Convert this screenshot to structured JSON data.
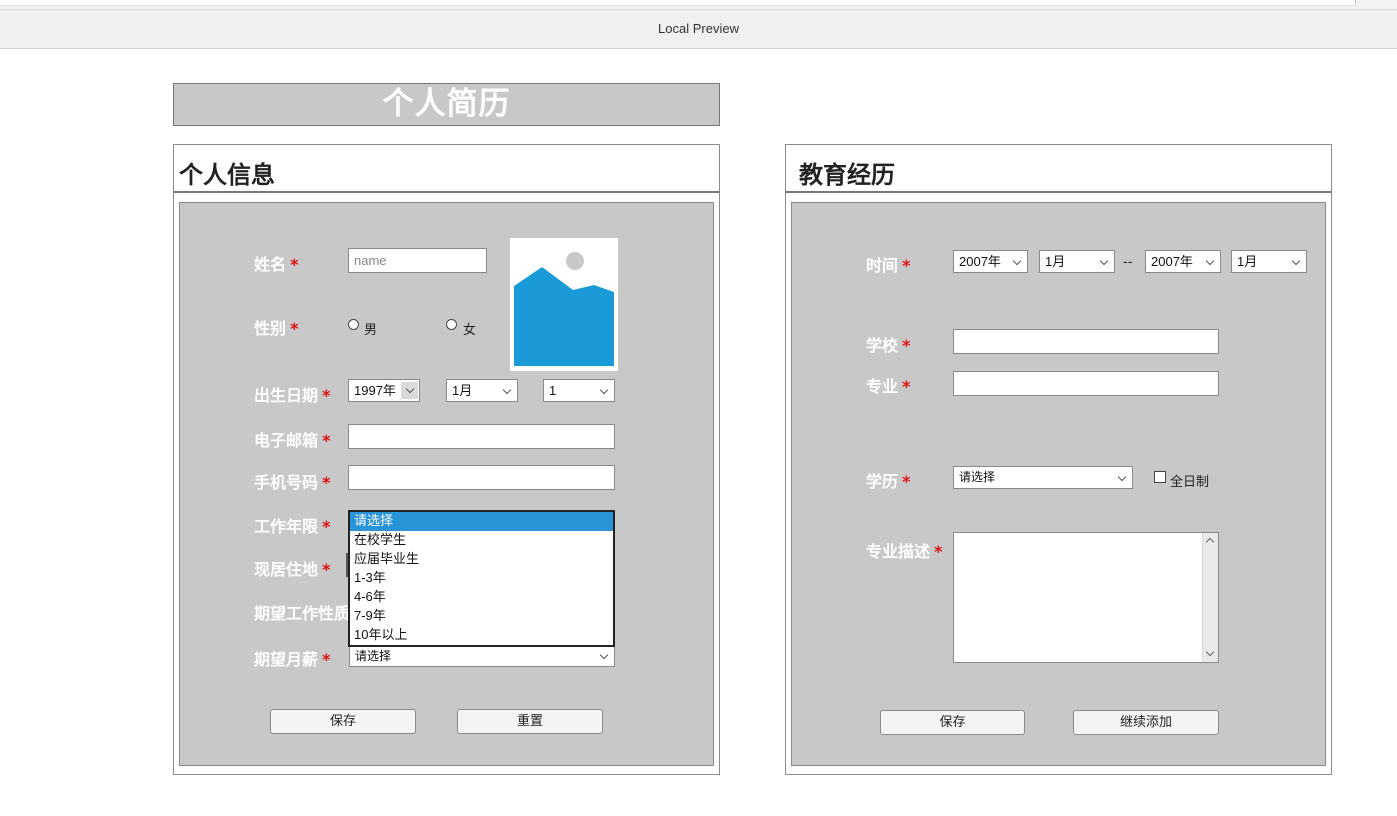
{
  "window": {
    "title": "Local Preview"
  },
  "resume": {
    "title": "个人简历"
  },
  "personal": {
    "heading": "个人信息",
    "name_label": "姓名",
    "name_placeholder": "name",
    "gender_label": "性别",
    "gender_male": "男",
    "gender_female": "女",
    "birth_label": "出生日期",
    "birth_year": "1997年",
    "birth_month": "1月",
    "birth_day": "1",
    "email_label": "电子邮箱",
    "phone_label": "手机号码",
    "work_years_label": "工作年限",
    "work_years_options": [
      "请选择",
      "在校学生",
      "应届毕业生",
      "1-3年",
      "4-6年",
      "7-9年",
      "10年以上"
    ],
    "residence_label": "现居住地",
    "job_type_label": "期望工作性质",
    "salary_label": "期望月薪",
    "salary_value": "请选择",
    "save_label": "保存",
    "reset_label": "重置",
    "star": "*"
  },
  "education": {
    "heading": "教育经历",
    "time_label": "时间",
    "start_year": "2007年",
    "start_month": "1月",
    "separator": "--",
    "end_year": "2007年",
    "end_month": "1月",
    "school_label": "学校",
    "major_label": "专业",
    "degree_label": "学历",
    "degree_value": "请选择",
    "fulltime_label": "全日制",
    "desc_label": "专业描述",
    "save_label": "保存",
    "add_label": "继续添加",
    "star": "*"
  },
  "colors": {
    "panel_bg": "#c8c8c8",
    "star": "#e01010",
    "selected_option": "#2a94d8",
    "photo_icon": "#1a9bd7"
  }
}
